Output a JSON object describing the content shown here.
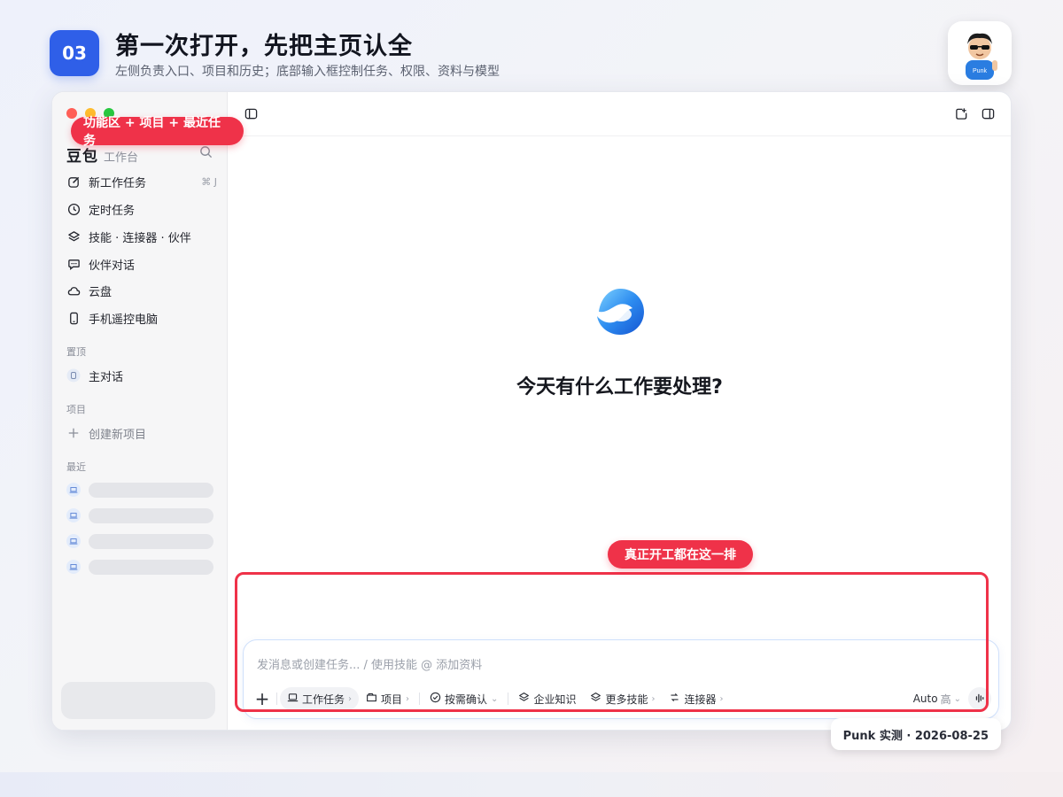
{
  "header": {
    "step_number": "03",
    "title": "第一次打开，先把主页认全",
    "subtitle": "左侧负责入口、项目和历史；底部输入框控制任务、权限、资料与模型",
    "avatar_text": "Punk"
  },
  "sidebar": {
    "brand_name": "豆包",
    "brand_sub": "工作台",
    "nav": [
      {
        "label": "新工作任务",
        "icon": "edit-icon",
        "shortcut": "⌘ J"
      },
      {
        "label": "定时任务",
        "icon": "clock-icon"
      },
      {
        "label": "技能 · 连接器 · 伙伴",
        "icon": "layers-icon"
      },
      {
        "label": "伙伴对话",
        "icon": "chat-icon"
      },
      {
        "label": "云盘",
        "icon": "cloud-icon"
      },
      {
        "label": "手机遥控电脑",
        "icon": "phone-icon"
      }
    ],
    "pinned_label": "置顶",
    "pinned_items": [
      {
        "label": "主对话",
        "icon": "chat-bubble-icon"
      }
    ],
    "projects_label": "项目",
    "new_project_label": "创建新项目",
    "recent_label": "最近"
  },
  "main": {
    "question": "今天有什么工作要处理?",
    "composer": {
      "placeholder": "发消息或创建任务... / 使用技能 @ 添加资料",
      "tools": [
        {
          "label": "工作任务",
          "icon": "laptop-icon",
          "chevron": true,
          "active": true
        },
        {
          "label": "项目",
          "icon": "project-icon",
          "chevron": true
        },
        {
          "label": "按需确认",
          "icon": "check-circle-icon",
          "chevron": true
        },
        {
          "label": "企业知识",
          "icon": "layers-icon",
          "chevron": false
        },
        {
          "label": "更多技能",
          "icon": "layers-icon",
          "chevron": true
        },
        {
          "label": "连接器",
          "icon": "connector-icon",
          "chevron": true
        }
      ],
      "model": "Auto",
      "level": "高"
    }
  },
  "annotations": {
    "sidebar_tag": "功能区 + 项目 + 最近任务",
    "composer_tag": "真正开工都在这一排"
  },
  "credit": "Punk 实测 · 2026-08-25",
  "colors": {
    "accent_blue": "#2f5fe8",
    "annotation_red": "#ef3249"
  }
}
